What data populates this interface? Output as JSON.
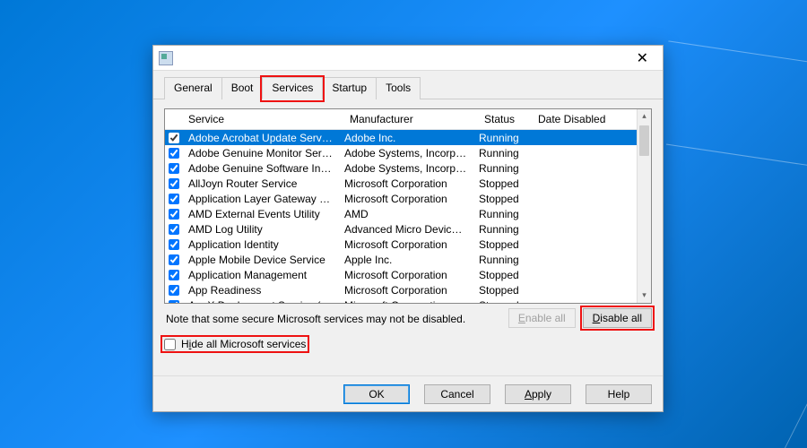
{
  "tabs": [
    "General",
    "Boot",
    "Services",
    "Startup",
    "Tools"
  ],
  "activeTabIndex": 2,
  "columns": {
    "service": "Service",
    "manufacturer": "Manufacturer",
    "status": "Status",
    "dateDisabled": "Date Disabled"
  },
  "rows": [
    {
      "svc": "Adobe Acrobat Update Service",
      "mfr": "Adobe Inc.",
      "st": "Running",
      "sel": true
    },
    {
      "svc": "Adobe Genuine Monitor Service",
      "mfr": "Adobe Systems, Incorpora...",
      "st": "Running"
    },
    {
      "svc": "Adobe Genuine Software Integri...",
      "mfr": "Adobe Systems, Incorpora...",
      "st": "Running"
    },
    {
      "svc": "AllJoyn Router Service",
      "mfr": "Microsoft Corporation",
      "st": "Stopped"
    },
    {
      "svc": "Application Layer Gateway Service",
      "mfr": "Microsoft Corporation",
      "st": "Stopped"
    },
    {
      "svc": "AMD External Events Utility",
      "mfr": "AMD",
      "st": "Running"
    },
    {
      "svc": "AMD Log Utility",
      "mfr": "Advanced Micro Devices, I...",
      "st": "Running"
    },
    {
      "svc": "Application Identity",
      "mfr": "Microsoft Corporation",
      "st": "Stopped"
    },
    {
      "svc": "Apple Mobile Device Service",
      "mfr": "Apple Inc.",
      "st": "Running"
    },
    {
      "svc": "Application Management",
      "mfr": "Microsoft Corporation",
      "st": "Stopped"
    },
    {
      "svc": "App Readiness",
      "mfr": "Microsoft Corporation",
      "st": "Stopped"
    },
    {
      "svc": "AppX Deployment Service (AppX...",
      "mfr": "Microsoft Corporation",
      "st": "Stopped"
    }
  ],
  "note": "Note that some secure Microsoft services may not be disabled.",
  "buttons": {
    "enableAll": "Enable all",
    "disableAll": "Disable all"
  },
  "hideCheckbox": {
    "pre": "H",
    "u": "i",
    "post": "de all Microsoft services"
  },
  "footer": {
    "ok": "OK",
    "cancel": "Cancel",
    "apply": "Apply",
    "help": "Help"
  },
  "enableU": "E",
  "enableRest": "nable all",
  "disableU": "D",
  "disableRest": "isable all",
  "applyU": "A",
  "applyRest": "pply"
}
